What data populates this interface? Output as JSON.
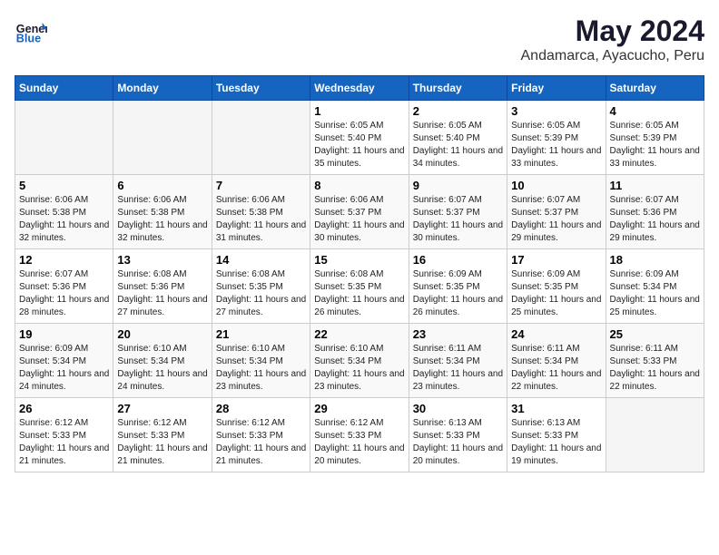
{
  "header": {
    "logo_line1": "General",
    "logo_line2": "Blue",
    "title": "May 2024",
    "subtitle": "Andamarca, Ayacucho, Peru"
  },
  "weekdays": [
    "Sunday",
    "Monday",
    "Tuesday",
    "Wednesday",
    "Thursday",
    "Friday",
    "Saturday"
  ],
  "weeks": [
    [
      {
        "day": "",
        "info": ""
      },
      {
        "day": "",
        "info": ""
      },
      {
        "day": "",
        "info": ""
      },
      {
        "day": "1",
        "info": "Sunrise: 6:05 AM\nSunset: 5:40 PM\nDaylight: 11 hours and 35 minutes."
      },
      {
        "day": "2",
        "info": "Sunrise: 6:05 AM\nSunset: 5:40 PM\nDaylight: 11 hours and 34 minutes."
      },
      {
        "day": "3",
        "info": "Sunrise: 6:05 AM\nSunset: 5:39 PM\nDaylight: 11 hours and 33 minutes."
      },
      {
        "day": "4",
        "info": "Sunrise: 6:05 AM\nSunset: 5:39 PM\nDaylight: 11 hours and 33 minutes."
      }
    ],
    [
      {
        "day": "5",
        "info": "Sunrise: 6:06 AM\nSunset: 5:38 PM\nDaylight: 11 hours and 32 minutes."
      },
      {
        "day": "6",
        "info": "Sunrise: 6:06 AM\nSunset: 5:38 PM\nDaylight: 11 hours and 32 minutes."
      },
      {
        "day": "7",
        "info": "Sunrise: 6:06 AM\nSunset: 5:38 PM\nDaylight: 11 hours and 31 minutes."
      },
      {
        "day": "8",
        "info": "Sunrise: 6:06 AM\nSunset: 5:37 PM\nDaylight: 11 hours and 30 minutes."
      },
      {
        "day": "9",
        "info": "Sunrise: 6:07 AM\nSunset: 5:37 PM\nDaylight: 11 hours and 30 minutes."
      },
      {
        "day": "10",
        "info": "Sunrise: 6:07 AM\nSunset: 5:37 PM\nDaylight: 11 hours and 29 minutes."
      },
      {
        "day": "11",
        "info": "Sunrise: 6:07 AM\nSunset: 5:36 PM\nDaylight: 11 hours and 29 minutes."
      }
    ],
    [
      {
        "day": "12",
        "info": "Sunrise: 6:07 AM\nSunset: 5:36 PM\nDaylight: 11 hours and 28 minutes."
      },
      {
        "day": "13",
        "info": "Sunrise: 6:08 AM\nSunset: 5:36 PM\nDaylight: 11 hours and 27 minutes."
      },
      {
        "day": "14",
        "info": "Sunrise: 6:08 AM\nSunset: 5:35 PM\nDaylight: 11 hours and 27 minutes."
      },
      {
        "day": "15",
        "info": "Sunrise: 6:08 AM\nSunset: 5:35 PM\nDaylight: 11 hours and 26 minutes."
      },
      {
        "day": "16",
        "info": "Sunrise: 6:09 AM\nSunset: 5:35 PM\nDaylight: 11 hours and 26 minutes."
      },
      {
        "day": "17",
        "info": "Sunrise: 6:09 AM\nSunset: 5:35 PM\nDaylight: 11 hours and 25 minutes."
      },
      {
        "day": "18",
        "info": "Sunrise: 6:09 AM\nSunset: 5:34 PM\nDaylight: 11 hours and 25 minutes."
      }
    ],
    [
      {
        "day": "19",
        "info": "Sunrise: 6:09 AM\nSunset: 5:34 PM\nDaylight: 11 hours and 24 minutes."
      },
      {
        "day": "20",
        "info": "Sunrise: 6:10 AM\nSunset: 5:34 PM\nDaylight: 11 hours and 24 minutes."
      },
      {
        "day": "21",
        "info": "Sunrise: 6:10 AM\nSunset: 5:34 PM\nDaylight: 11 hours and 23 minutes."
      },
      {
        "day": "22",
        "info": "Sunrise: 6:10 AM\nSunset: 5:34 PM\nDaylight: 11 hours and 23 minutes."
      },
      {
        "day": "23",
        "info": "Sunrise: 6:11 AM\nSunset: 5:34 PM\nDaylight: 11 hours and 23 minutes."
      },
      {
        "day": "24",
        "info": "Sunrise: 6:11 AM\nSunset: 5:34 PM\nDaylight: 11 hours and 22 minutes."
      },
      {
        "day": "25",
        "info": "Sunrise: 6:11 AM\nSunset: 5:33 PM\nDaylight: 11 hours and 22 minutes."
      }
    ],
    [
      {
        "day": "26",
        "info": "Sunrise: 6:12 AM\nSunset: 5:33 PM\nDaylight: 11 hours and 21 minutes."
      },
      {
        "day": "27",
        "info": "Sunrise: 6:12 AM\nSunset: 5:33 PM\nDaylight: 11 hours and 21 minutes."
      },
      {
        "day": "28",
        "info": "Sunrise: 6:12 AM\nSunset: 5:33 PM\nDaylight: 11 hours and 21 minutes."
      },
      {
        "day": "29",
        "info": "Sunrise: 6:12 AM\nSunset: 5:33 PM\nDaylight: 11 hours and 20 minutes."
      },
      {
        "day": "30",
        "info": "Sunrise: 6:13 AM\nSunset: 5:33 PM\nDaylight: 11 hours and 20 minutes."
      },
      {
        "day": "31",
        "info": "Sunrise: 6:13 AM\nSunset: 5:33 PM\nDaylight: 11 hours and 19 minutes."
      },
      {
        "day": "",
        "info": ""
      }
    ]
  ]
}
